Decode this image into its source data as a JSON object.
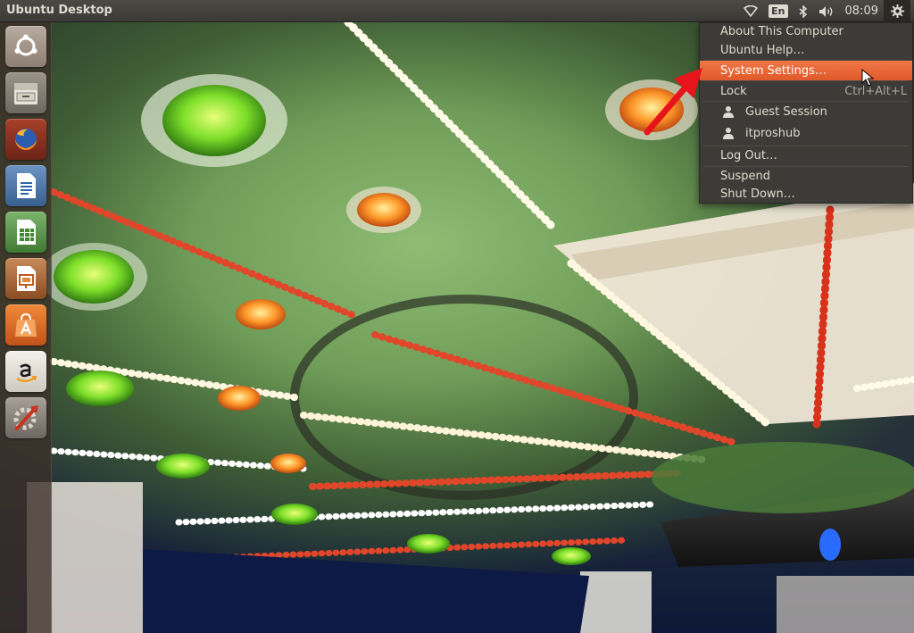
{
  "panel": {
    "title": "Ubuntu Desktop",
    "keyboard_layout": "En",
    "clock": "08:09",
    "indicators": [
      "network-icon",
      "keyboard-layout",
      "bluetooth-icon",
      "volume-icon",
      "clock",
      "gear-icon"
    ]
  },
  "launcher": {
    "items": [
      {
        "name": "dash-home",
        "icon": "ubuntu-logo-icon"
      },
      {
        "name": "files",
        "icon": "file-cabinet-icon"
      },
      {
        "name": "firefox",
        "icon": "firefox-icon"
      },
      {
        "name": "libreoffice-writer",
        "icon": "writer-document-icon"
      },
      {
        "name": "libreoffice-calc",
        "icon": "calc-spreadsheet-icon"
      },
      {
        "name": "libreoffice-impress",
        "icon": "impress-presentation-icon"
      },
      {
        "name": "ubuntu-software-center",
        "icon": "shopping-bag-icon"
      },
      {
        "name": "amazon",
        "icon": "amazon-icon"
      },
      {
        "name": "system-settings",
        "icon": "settings-tools-icon"
      }
    ]
  },
  "session_menu": {
    "about": "About This Computer",
    "help": "Ubuntu Help…",
    "system_settings": "System Settings…",
    "lock": "Lock",
    "lock_accel": "Ctrl+Alt+L",
    "guest_session": "Guest Session",
    "user": "itproshub",
    "log_out": "Log Out…",
    "suspend": "Suspend",
    "shut_down": "Shut Down…",
    "highlighted": "system_settings"
  },
  "colors": {
    "panel_bg": "#3c3b37",
    "menu_bg": "#3c3b37",
    "highlight": "#e95420",
    "annotation_arrow": "#e8141c"
  }
}
